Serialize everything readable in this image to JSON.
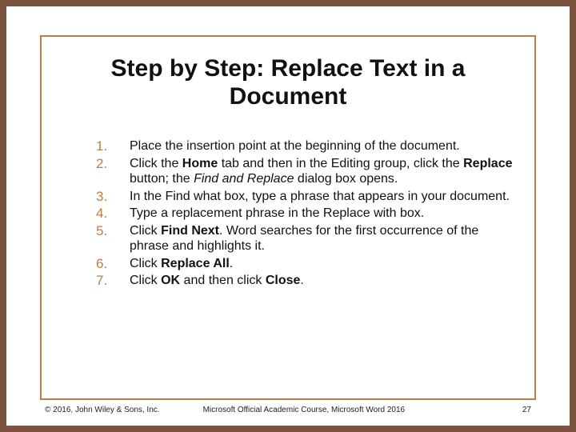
{
  "title": "Step by Step: Replace Text in a Document",
  "steps": [
    {
      "html": "Place the insertion point at the beginning of the document."
    },
    {
      "html": "Click the <span class=\"b\">Home</span> tab and then in the Editing group, click the <span class=\"b\">Replace</span> button; the <span class=\"i\">Find and Replace</span> dialog box opens."
    },
    {
      "html": "In the Find what box, type a phrase that appears in your document."
    },
    {
      "html": "Type a replacement phrase in the Replace with box."
    },
    {
      "html": "Click <span class=\"b\">Find Next</span>. Word searches for the first occurrence of the phrase and highlights it."
    },
    {
      "html": "Click <span class=\"b\">Replace All</span>."
    },
    {
      "html": "Click <span class=\"b\">OK</span> and then click <span class=\"b\">Close</span>."
    }
  ],
  "footer": {
    "copyright": "© 2016, John Wiley & Sons, Inc.",
    "course": "Microsoft Official Academic Course, Microsoft Word 2016",
    "page": "27"
  }
}
